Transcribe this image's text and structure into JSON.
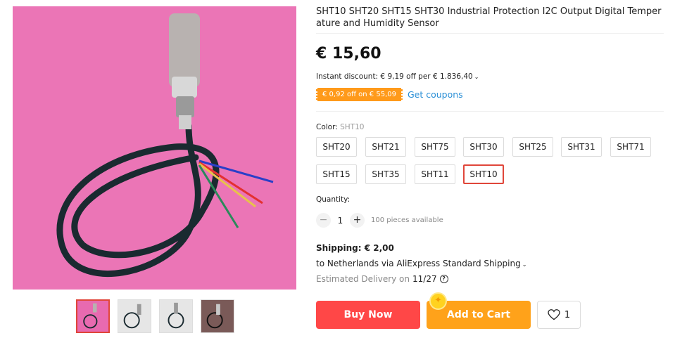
{
  "product": {
    "title": "SHT10 SHT20 SHT15 SHT30 Industrial Protection I2C Output Digital Temperature and Humidity Sensor",
    "price": "€ 15,60",
    "instant_discount": "Instant discount: € 9,19 off per € 1.836,40",
    "coupon_badge": "€ 0,92 off on € 55,09",
    "get_coupons": "Get coupons"
  },
  "color": {
    "label": "Color: ",
    "selected": "SHT10",
    "options": [
      "SHT20",
      "SHT21",
      "SHT75",
      "SHT30",
      "SHT25",
      "SHT31",
      "SHT71",
      "SHT15",
      "SHT35",
      "SHT11",
      "SHT10"
    ]
  },
  "quantity": {
    "label": "Quantity:",
    "minus": "−",
    "value": "1",
    "plus": "+",
    "available": "100 pieces available"
  },
  "shipping": {
    "title": "Shipping: € 2,00",
    "to": "to Netherlands via AliExpress Standard Shipping",
    "delivery_label": "Estimated Delivery on",
    "delivery_date": "11/27"
  },
  "actions": {
    "buy_now": "Buy Now",
    "add_to_cart": "Add to Cart",
    "wishlist_count": "1"
  },
  "icons": {
    "chevron": "chevron-down-icon",
    "help": "help-icon",
    "heart": "heart-icon",
    "coin": "coin-icon"
  },
  "colors": {
    "accent_red": "#ff4747",
    "accent_orange": "#ffa21a",
    "link_blue": "#2a8fd6",
    "image_background": "#e86ab0"
  }
}
